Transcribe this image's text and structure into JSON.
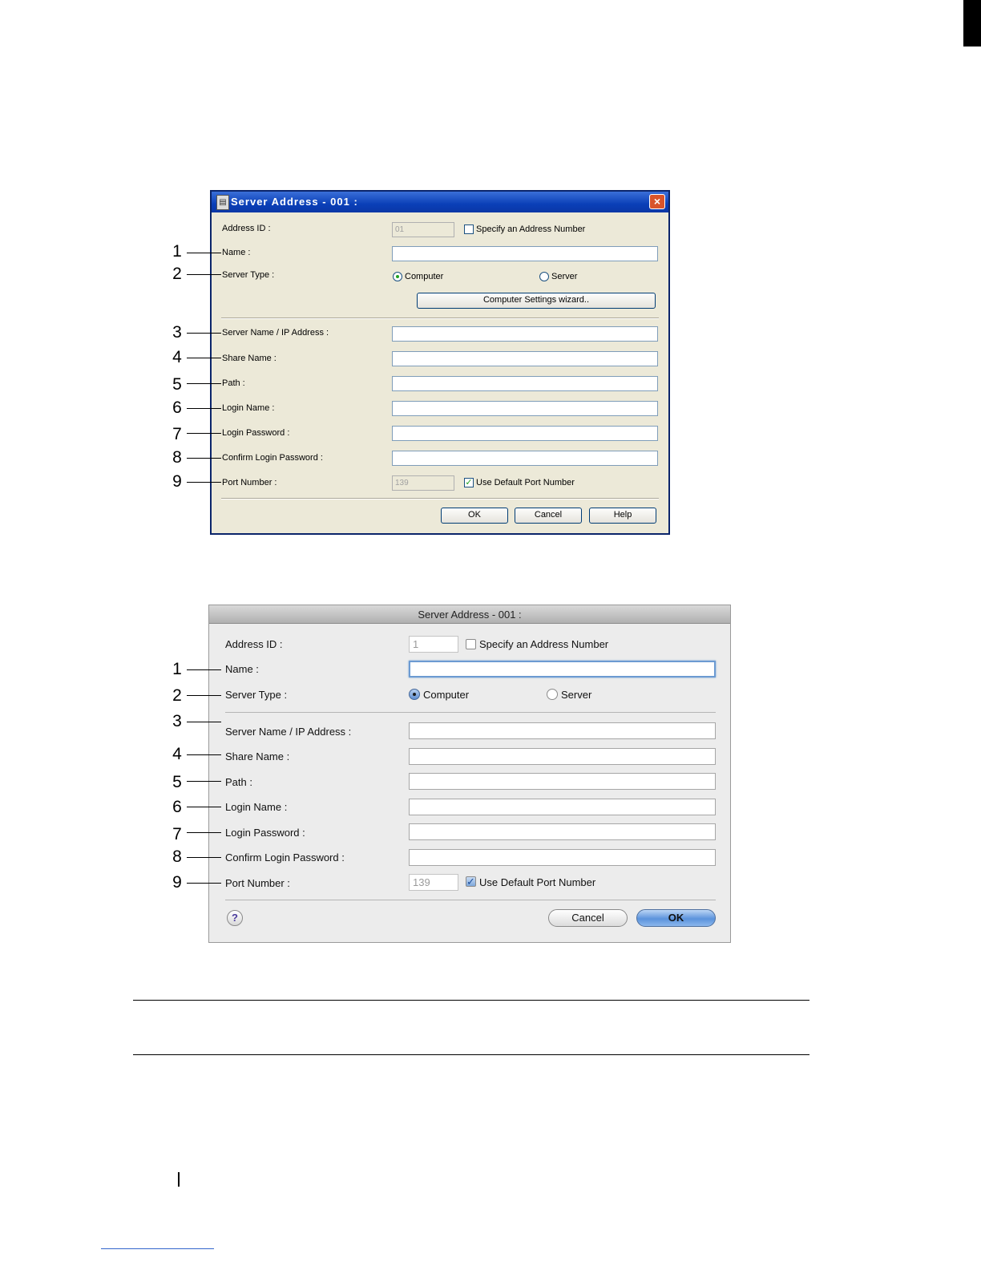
{
  "windows_dialog": {
    "title": "Server Address - 001 :",
    "close_label": "×",
    "address_id_label": "Address ID :",
    "address_id_value": "01",
    "specify_address_label": "Specify an Address Number",
    "name_label": "Name :",
    "server_type_label": "Server Type :",
    "computer_label": "Computer",
    "server_label": "Server",
    "wizard_button": "Computer Settings wizard..",
    "server_name_label": "Server Name / IP Address :",
    "share_name_label": "Share Name :",
    "path_label": "Path :",
    "login_name_label": "Login Name :",
    "login_password_label": "Login Password :",
    "confirm_password_label": "Confirm Login Password :",
    "port_number_label": "Port Number :",
    "port_number_value": "139",
    "use_default_port_label": "Use Default Port Number",
    "ok_button": "OK",
    "cancel_button": "Cancel",
    "help_button": "Help"
  },
  "mac_dialog": {
    "title": "Server Address - 001 :",
    "address_id_label": "Address ID :",
    "address_id_value": "1",
    "specify_address_label": "Specify an Address Number",
    "name_label": "Name :",
    "server_type_label": "Server Type :",
    "computer_label": "Computer",
    "server_label": "Server",
    "server_name_label": "Server Name / IP Address :",
    "share_name_label": "Share Name :",
    "path_label": "Path :",
    "login_name_label": "Login Name :",
    "login_password_label": "Login Password :",
    "confirm_password_label": "Confirm Login Password :",
    "port_number_label": "Port Number :",
    "port_number_value": "139",
    "use_default_port_label": "Use Default Port Number",
    "help_label": "?",
    "cancel_button": "Cancel",
    "ok_button": "OK"
  },
  "callouts": {
    "n1": "1",
    "n2": "2",
    "n3": "3",
    "n4": "4",
    "n5": "5",
    "n6": "6",
    "n7": "7",
    "n8": "8",
    "n9": "9"
  },
  "check_mark": "✓",
  "colors": {
    "windows_title_blue": "#0a3fb8",
    "windows_close_red": "#d9542b",
    "windows_check_green": "#21a121",
    "mac_focus_blue": "#6c9bd2"
  }
}
